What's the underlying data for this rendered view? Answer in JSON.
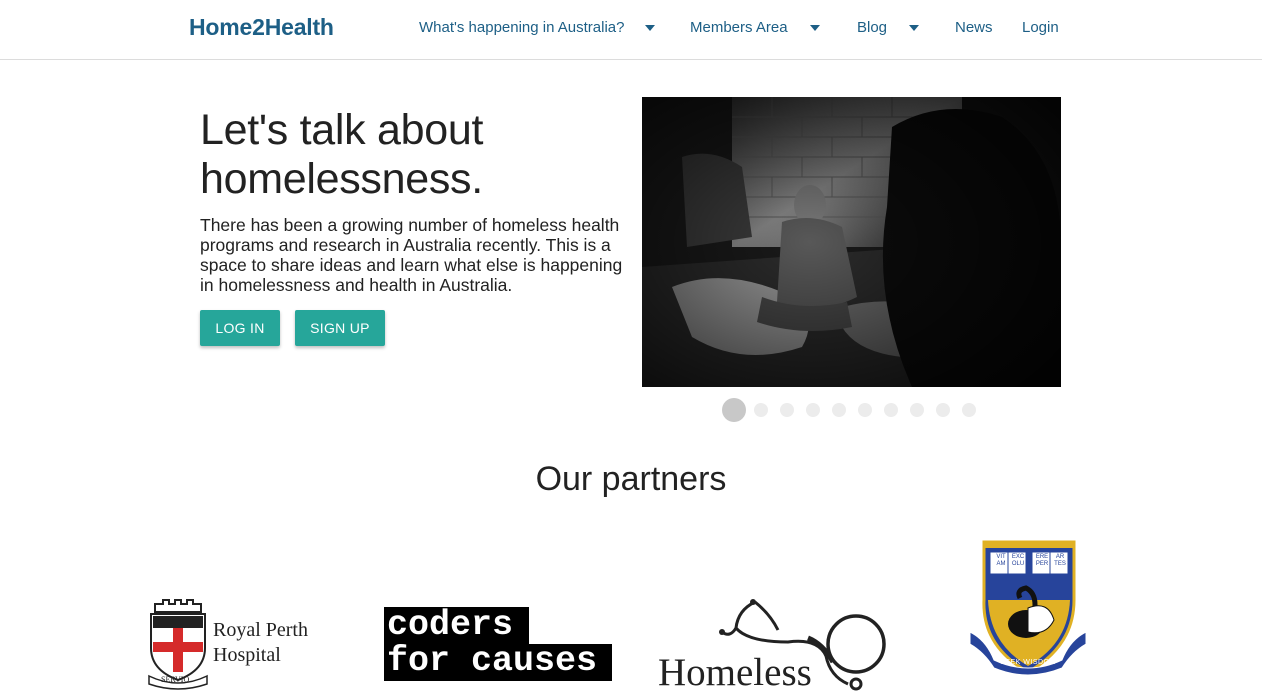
{
  "nav": {
    "brand": "Home2Health",
    "items": [
      {
        "label": "What's happening in Australia?",
        "dropdown": true
      },
      {
        "label": "Members Area",
        "dropdown": true
      },
      {
        "label": "Blog",
        "dropdown": true
      },
      {
        "label": "News",
        "dropdown": false
      },
      {
        "label": "Login",
        "dropdown": false
      }
    ]
  },
  "hero": {
    "title_line1": "Let's talk about",
    "title_line2": "homelessness.",
    "text": "There has been a growing number of homeless health programs and research in Australia recently. This is a space to share ideas and learn what else is happening in homelessness and health in Australia.",
    "login_label": "LOG IN",
    "signup_label": "SIGN UP"
  },
  "carousel": {
    "image": "homeless-man-photo",
    "slide_count": 10,
    "active_index": 0
  },
  "partners": {
    "title": "Our partners",
    "logos": [
      {
        "name": "Royal Perth Hospital",
        "line1": "Royal Perth",
        "line2": "Hospital",
        "motto": "SERVIO"
      },
      {
        "name": "Coders for Causes",
        "line1": "coders",
        "line2": "for causes"
      },
      {
        "name": "Homeless Healthcare",
        "line1": "Homeless"
      },
      {
        "name": "University of Western Australia",
        "motto": "SEEK WISDOM",
        "book_left": "VIT AM",
        "book_left2": "EXC OLU",
        "book_right": "ERE PER",
        "book_right2": "AR TES"
      }
    ]
  },
  "colors": {
    "brand": "#1d5f86",
    "button": "#26a69a",
    "text": "#222222"
  }
}
